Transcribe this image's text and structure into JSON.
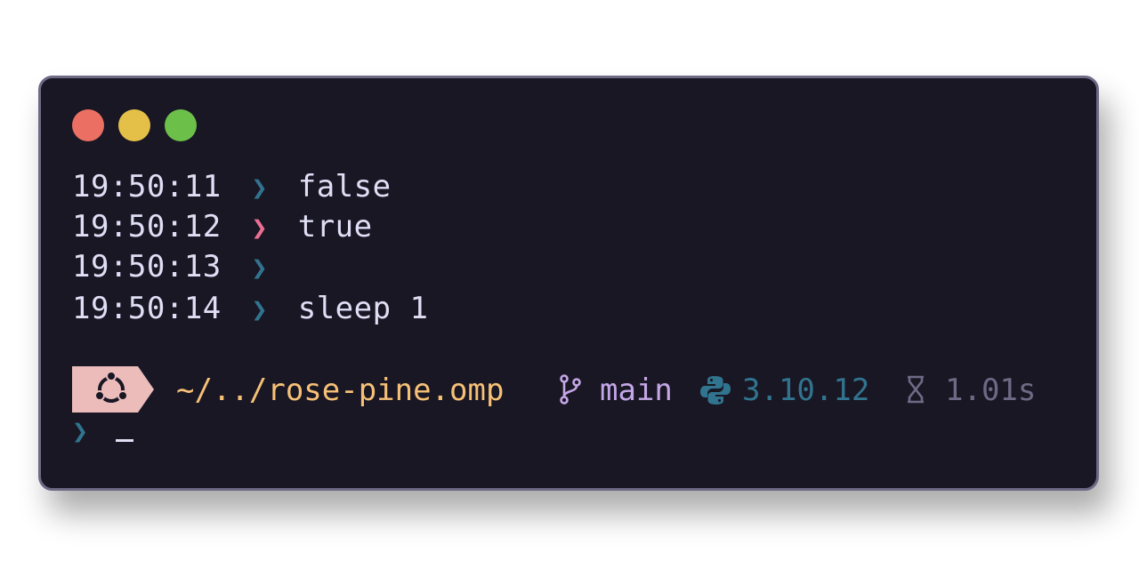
{
  "colors": {
    "background": "#191724",
    "border": "#6e6a86",
    "text": "#e0def4",
    "dot_close": "#eb6f62",
    "dot_minimize": "#e4c048",
    "dot_zoom": "#6cc04a",
    "chevron_success": "#31748f",
    "chevron_error": "#eb6f92",
    "os_badge_bg": "#ebbcba",
    "os_icon": "#191724",
    "path": "#f6c177",
    "git": "#c4a7e7",
    "python": "#31748f",
    "duration": "#6e6a86"
  },
  "history": [
    {
      "time": "19:50:11",
      "chevron": "❯",
      "status": "success",
      "command": "false"
    },
    {
      "time": "19:50:12",
      "chevron": "❯",
      "status": "error",
      "command": "true"
    },
    {
      "time": "19:50:13",
      "chevron": "❯",
      "status": "success",
      "command": ""
    },
    {
      "time": "19:50:14",
      "chevron": "❯",
      "status": "success",
      "command": "sleep 1"
    }
  ],
  "prompt": {
    "os_icon": "ubuntu-icon",
    "path": "~/../rose-pine.omp",
    "git_icon": "git-branch-icon",
    "git_branch": "main",
    "python_icon": "python-icon",
    "python_version": "3.10.12",
    "duration_icon": "hourglass-icon",
    "duration": "1.01s",
    "input_chevron": "❯",
    "input": ""
  }
}
